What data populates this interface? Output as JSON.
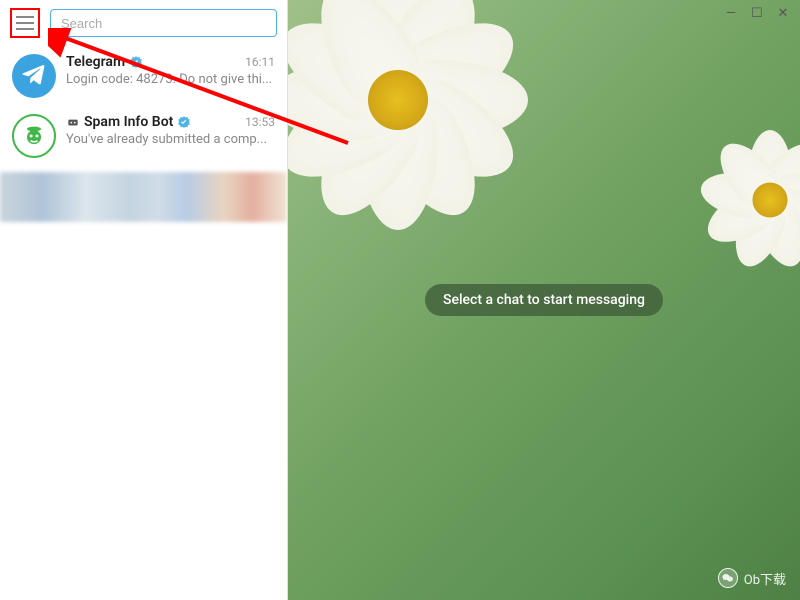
{
  "window": {
    "minimize": "—",
    "maximize": "☐",
    "close": "✕"
  },
  "search": {
    "placeholder": "Search"
  },
  "chats": [
    {
      "name": "Telegram",
      "verified": true,
      "time": "16:11",
      "preview": "Login code: 48273. Do not give thi..."
    },
    {
      "name": "Spam Info Bot",
      "verified": true,
      "time": "13:53",
      "preview": "You've already submitted a comp..."
    }
  ],
  "main": {
    "empty_message": "Select a chat to start messaging"
  },
  "watermark": {
    "label": "Ob下载"
  }
}
